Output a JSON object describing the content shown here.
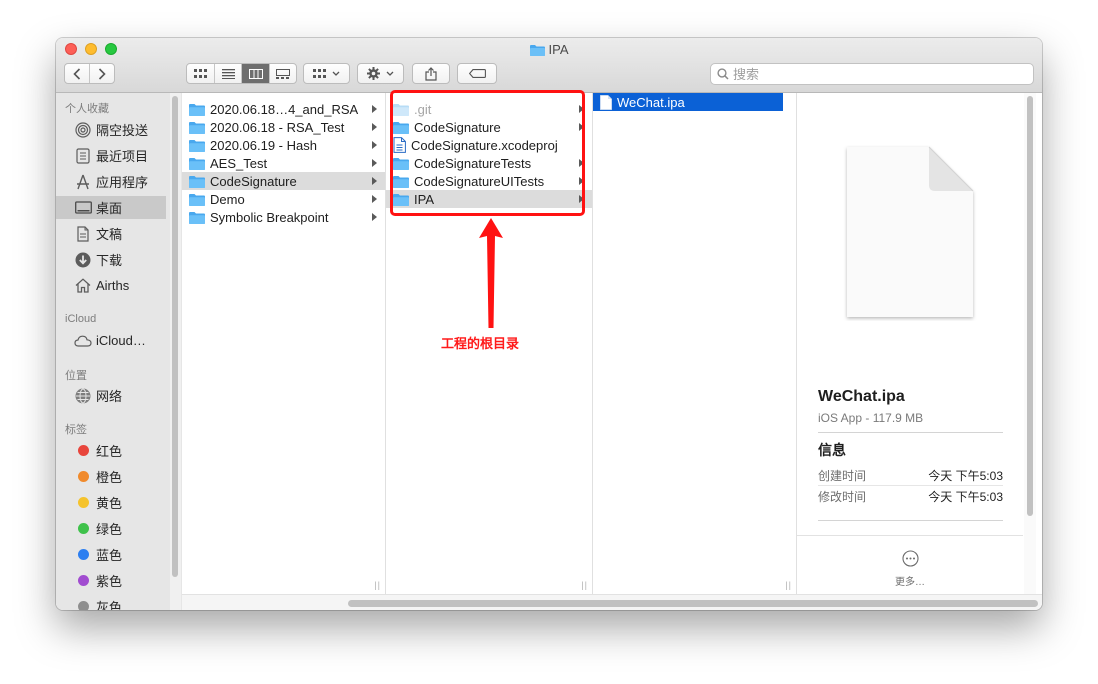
{
  "window": {
    "title": "IPA"
  },
  "toolbar": {
    "back_icon": "chevron-left-icon",
    "forward_icon": "chevron-right-icon",
    "view_modes": [
      "icon-view",
      "list-view",
      "column-view",
      "gallery-view"
    ],
    "selected_view": "column-view",
    "search_placeholder": "搜索"
  },
  "sidebar": {
    "sections": [
      {
        "title": "个人收藏",
        "items": [
          {
            "label": "隔空投送",
            "icon": "airdrop-icon"
          },
          {
            "label": "最近项目",
            "icon": "recents-icon"
          },
          {
            "label": "应用程序",
            "icon": "applications-icon"
          },
          {
            "label": "桌面",
            "icon": "desktop-icon",
            "selected": true
          },
          {
            "label": "文稿",
            "icon": "documents-icon"
          },
          {
            "label": "下载",
            "icon": "downloads-icon"
          },
          {
            "label": "Airths",
            "icon": "home-icon"
          }
        ]
      },
      {
        "title": "iCloud",
        "items": [
          {
            "label": "iCloud…",
            "icon": "cloud-icon"
          }
        ]
      },
      {
        "title": "位置",
        "items": [
          {
            "label": "网络",
            "icon": "network-icon"
          }
        ]
      },
      {
        "title": "标签",
        "items": [
          {
            "label": "红色",
            "color": "#e8453c"
          },
          {
            "label": "橙色",
            "color": "#f08a2c"
          },
          {
            "label": "黄色",
            "color": "#f5c32c"
          },
          {
            "label": "绿色",
            "color": "#3fc24b"
          },
          {
            "label": "蓝色",
            "color": "#2d7ff0"
          },
          {
            "label": "紫色",
            "color": "#a14cd0"
          },
          {
            "label": "灰色",
            "color": "#8e8e8e"
          }
        ]
      }
    ]
  },
  "columns": [
    {
      "rows": [
        {
          "label": "2020.06.18…4_and_RSA",
          "type": "folder",
          "arrow": true
        },
        {
          "label": "2020.06.18 - RSA_Test",
          "type": "folder",
          "arrow": true
        },
        {
          "label": "2020.06.19 - Hash",
          "type": "folder",
          "arrow": true
        },
        {
          "label": "AES_Test",
          "type": "folder",
          "arrow": true
        },
        {
          "label": "CodeSignature",
          "type": "folder",
          "arrow": true,
          "state": "path"
        },
        {
          "label": "Demo",
          "type": "folder",
          "arrow": true
        },
        {
          "label": "Symbolic Breakpoint",
          "type": "folder",
          "arrow": true
        }
      ]
    },
    {
      "rows": [
        {
          "label": ".git",
          "type": "folder",
          "arrow": true,
          "dim": true
        },
        {
          "label": "CodeSignature",
          "type": "folder",
          "arrow": true
        },
        {
          "label": "CodeSignature.xcodeproj",
          "type": "xcodeproj",
          "arrow": false
        },
        {
          "label": "CodeSignatureTests",
          "type": "folder",
          "arrow": true
        },
        {
          "label": "CodeSignatureUITests",
          "type": "folder",
          "arrow": true
        },
        {
          "label": "IPA",
          "type": "folder",
          "arrow": true,
          "state": "path"
        }
      ]
    },
    {
      "rows": [
        {
          "label": "WeChat.ipa",
          "type": "file",
          "arrow": false,
          "state": "selected"
        }
      ]
    }
  ],
  "preview": {
    "name": "WeChat.ipa",
    "subtitle": "iOS App - 117.9 MB",
    "info_title": "信息",
    "rows": [
      {
        "key": "创建时间",
        "value": "今天 下午5:03"
      },
      {
        "key": "修改时间",
        "value": "今天 下午5:03"
      }
    ],
    "more_label": "更多…"
  },
  "annotation": {
    "text": "工程的根目录",
    "color": "#ff1a1a"
  },
  "colors": {
    "selection": "#0b61d6",
    "path_highlight": "#dcdcdc",
    "folder": "#49a8ee"
  }
}
